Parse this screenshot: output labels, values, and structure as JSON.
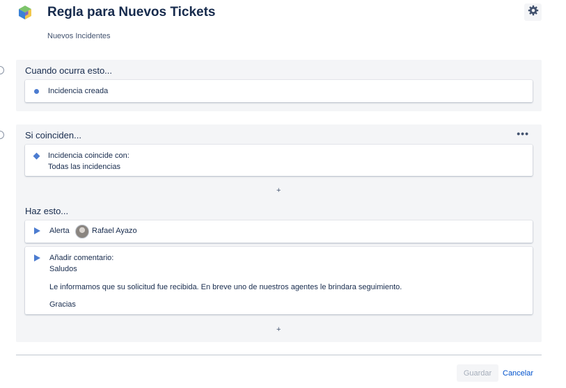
{
  "header": {
    "title": "Regla para Nuevos Tickets",
    "subtitle": "Nuevos Incidentes"
  },
  "trigger": {
    "title": "Cuando ocurra esto...",
    "item": "Incidencia creada"
  },
  "condition": {
    "title": "Si coinciden...",
    "more_label": "•••",
    "item_line1": "Incidencia coincide con:",
    "item_line2": "Todas las incidencias",
    "add_label": "+"
  },
  "actions": {
    "title": "Haz esto...",
    "alert": {
      "label": "Alerta",
      "user": "Rafael Ayazo"
    },
    "comment": {
      "label": "Añadir comentario:",
      "lines": [
        "Saludos",
        "Le informamos que su solicitud fue recibida. En breve uno de nuestros agentes le brindara seguimiento.",
        "Gracias"
      ]
    },
    "add_label": "+"
  },
  "footer": {
    "save_label": "Guardar",
    "cancel_label": "Cancelar"
  },
  "colors": {
    "accent": "#4c7cd0",
    "link": "#0052cc",
    "panel_bg": "#f4f5f7"
  },
  "icons": {
    "logo": "cube-logo-icon",
    "settings": "gear-icon",
    "trigger": "dot-icon",
    "condition": "diamond-icon",
    "action": "play-triangle-icon"
  }
}
